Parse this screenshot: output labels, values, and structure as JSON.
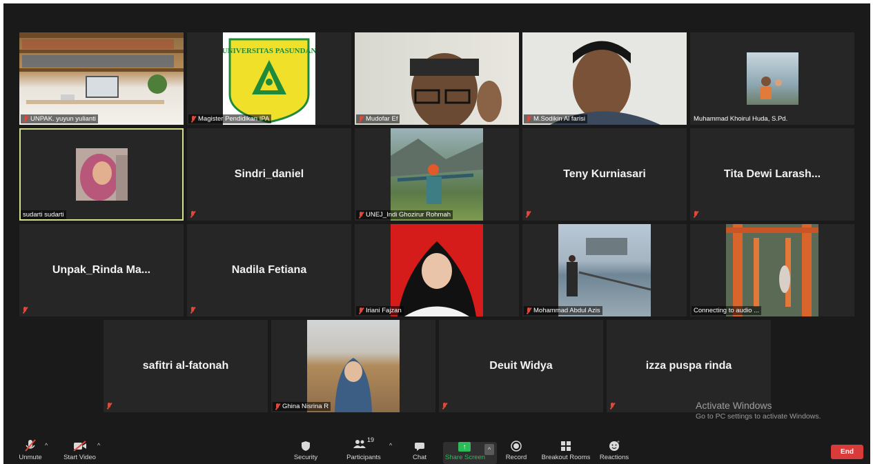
{
  "participants_grid": [
    {
      "name": "UNPAK. yuyun yulianti"
    },
    {
      "name": "Magister Pendidikan IPA"
    },
    {
      "name": "Mudofar Ef"
    },
    {
      "name": "M.Sodikin Al farisi"
    },
    {
      "name": "Muhammad Khoirul Huda, S.Pd."
    },
    {
      "name": "sudarti sudarti"
    },
    {
      "name": "Sindri_daniel"
    },
    {
      "name": "UNEJ_Indi Ghozirur Rohmah"
    },
    {
      "name": "Teny Kurniasari"
    },
    {
      "name": "Tita Dewi Larash..."
    },
    {
      "name": "Unpak_Rinda  Ma..."
    },
    {
      "name": "Nadila Fetiana"
    },
    {
      "name": "Iriani Fajzan"
    },
    {
      "name": "Mohammad Abdul Azis"
    },
    {
      "name": "Connecting to audio ..."
    },
    {
      "name": "safitri al-fatonah"
    },
    {
      "name": "Ghina Nisrina R"
    },
    {
      "name": "Deuit Widya"
    },
    {
      "name": "izza puspa rinda"
    }
  ],
  "logo_text": "UNIVERSITAS PASUNDAN",
  "watermark": {
    "title": "Activate Windows",
    "subtitle": "Go to PC settings to activate Windows."
  },
  "toolbar": {
    "unmute": "Unmute",
    "start_video": "Start Video",
    "security": "Security",
    "participants": "Participants",
    "participants_count": "19",
    "chat": "Chat",
    "share_screen": "Share Screen",
    "record": "Record",
    "breakout_rooms": "Breakout Rooms",
    "reactions": "Reactions",
    "end": "End"
  },
  "icons": [
    "microphone-muted-icon",
    "video-off-icon",
    "shield-icon",
    "participants-icon",
    "chat-icon",
    "share-screen-icon",
    "record-icon",
    "breakout-rooms-icon",
    "reactions-icon"
  ],
  "colors": {
    "background": "#1a1a1a",
    "tile": "#262626",
    "active_border": "#d6e08a",
    "end_button": "#d93a3a",
    "share_green": "#2dbb5a",
    "muted_red": "#e0483a"
  }
}
